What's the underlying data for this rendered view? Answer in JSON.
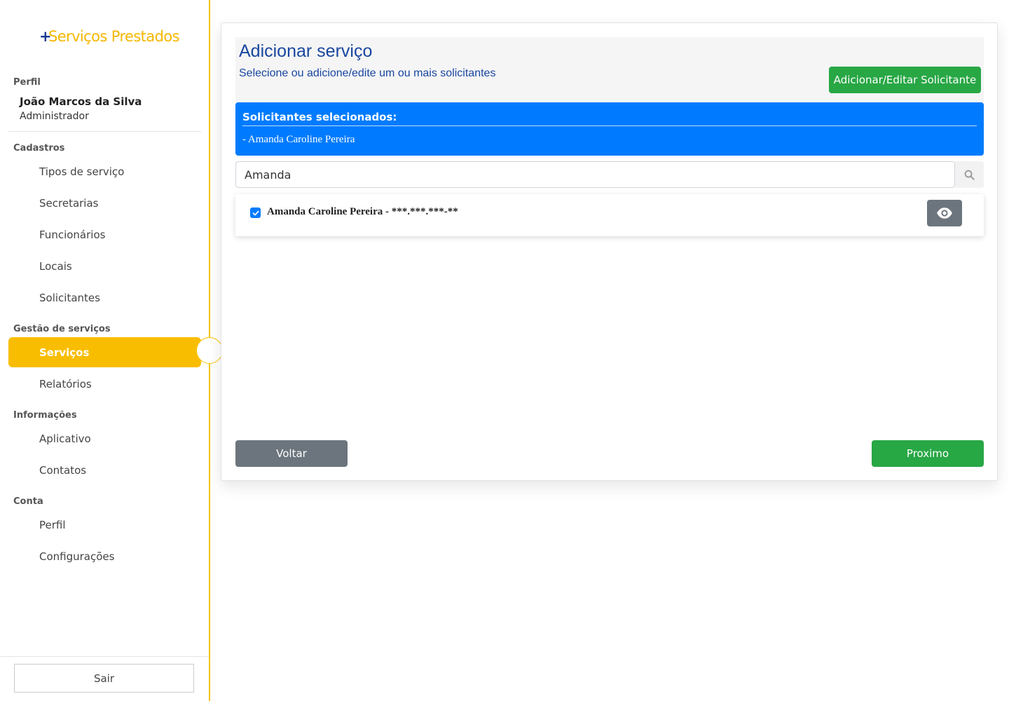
{
  "sidebar": {
    "logo_plus": "+",
    "logo_text": "Serviços Prestados",
    "profile_section": "Perfil",
    "user_name": "João Marcos da Silva",
    "user_role": "Administrador",
    "sections": {
      "cadastros": "Cadastros",
      "gestao": "Gestão de serviços",
      "informacoes": "Informações",
      "conta": "Conta"
    },
    "items": {
      "tipos": "Tipos de serviço",
      "secretarias": "Secretarias",
      "funcionarios": "Funcionários",
      "locais": "Locais",
      "solicitantes": "Solicitantes",
      "servicos": "Serviços",
      "relatorios": "Relatórios",
      "aplicativo": "Aplicativo",
      "contatos": "Contatos",
      "perfil": "Perfil",
      "configuracoes": "Configurações"
    },
    "active_item": "servicos",
    "logout_label": "Sair"
  },
  "main": {
    "title": "Adicionar serviço",
    "subtitle": "Selecione ou adicione/edite um ou mais solicitantes",
    "add_button": "Adicionar/Editar Solicitante",
    "selected_title": "Solicitantes selecionados:",
    "selected_items": [
      "- Amanda Caroline Pereira"
    ],
    "search_value": "Amanda",
    "results": [
      {
        "name": "Amanda Caroline Pereira - ***.***.***-**",
        "checked": true
      }
    ],
    "back_button": "Voltar",
    "next_button": "Proximo"
  },
  "colors": {
    "accent_yellow": "#f9bd00",
    "primary_blue": "#007bff",
    "title_blue": "#1a47a0",
    "success_green": "#28a745",
    "secondary_gray": "#6c757d"
  },
  "icons": {
    "search": "search-icon",
    "eye": "eye-icon",
    "check": "check-icon"
  }
}
